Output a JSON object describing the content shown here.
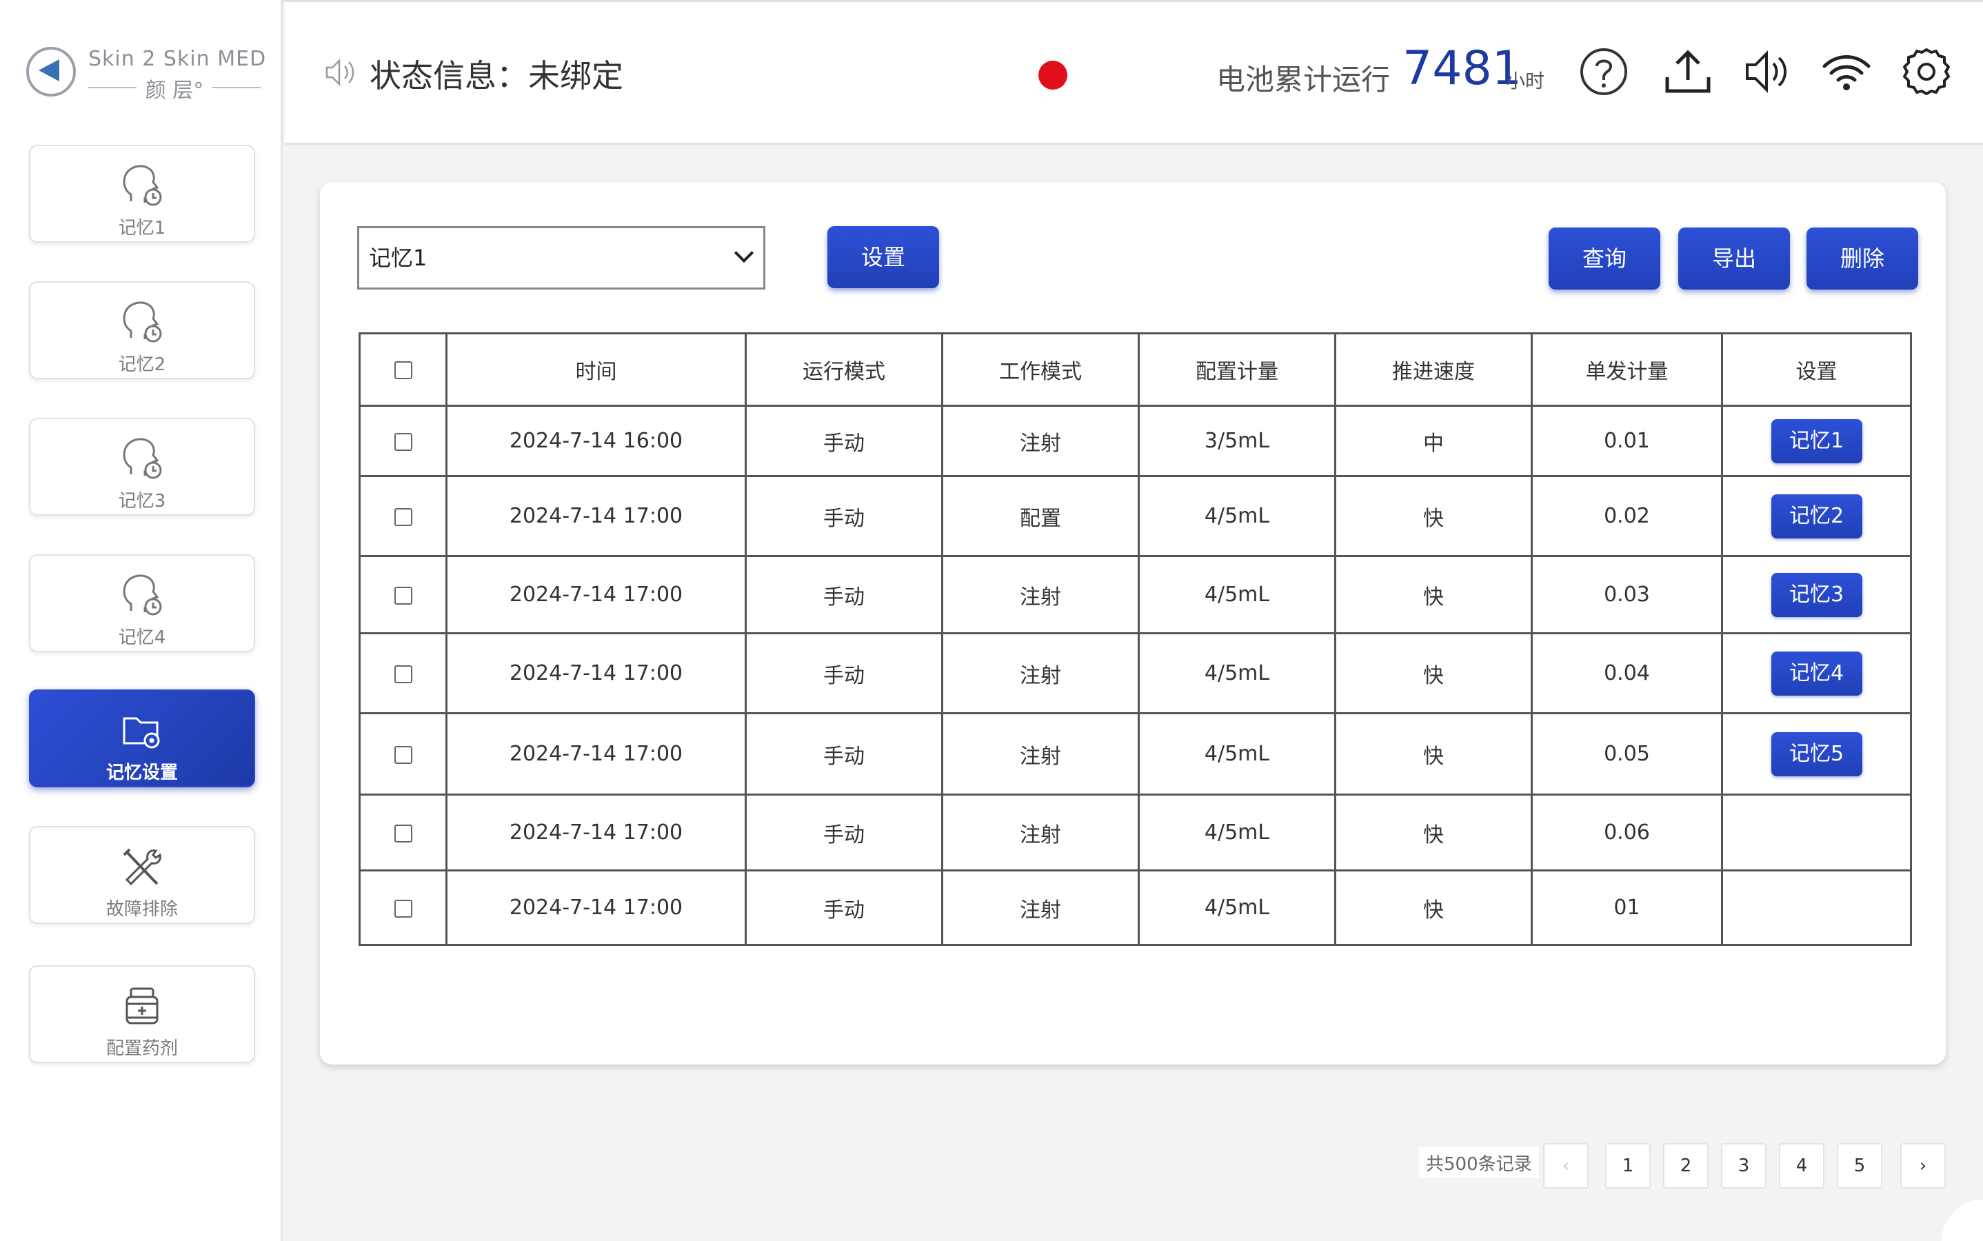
{
  "logo": {
    "line1": "Skin 2 Skin MED",
    "line2": "颜 层°"
  },
  "sidebar": {
    "items": [
      {
        "label": "记忆1",
        "icon": "head-clock-icon"
      },
      {
        "label": "记忆2",
        "icon": "head-clock-icon"
      },
      {
        "label": "记忆3",
        "icon": "head-clock-icon"
      },
      {
        "label": "记忆4",
        "icon": "head-clock-icon"
      },
      {
        "label": "记忆设置",
        "icon": "folder-gear-icon",
        "active": true
      },
      {
        "label": "故障排除",
        "icon": "tools-icon"
      },
      {
        "label": "配置药剂",
        "icon": "bottle-icon"
      }
    ]
  },
  "header": {
    "status_label": "状态信息：未绑定",
    "status_color": "#e0101a",
    "battery_label": "电池累计运行",
    "battery_value": "7481",
    "battery_unit": "小时",
    "icons": [
      "help-icon",
      "upload-icon",
      "volume-icon",
      "wifi-icon",
      "settings-icon"
    ]
  },
  "toolbar": {
    "select_value": "记忆1",
    "set_label": "设置",
    "query_label": "查询",
    "export_label": "导出",
    "delete_label": "删除"
  },
  "table": {
    "headers": [
      "时间",
      "运行模式",
      "工作模式",
      "配置计量",
      "推进速度",
      "单发计量",
      "设置"
    ],
    "rows": [
      {
        "time": "2024-7-14 16:00",
        "run_mode": "手动",
        "work_mode": "注射",
        "config": "3/5mL",
        "speed": "中",
        "dose": "0.01",
        "memory": "记忆1"
      },
      {
        "time": "2024-7-14 17:00",
        "run_mode": "手动",
        "work_mode": "配置",
        "config": "4/5mL",
        "speed": "快",
        "dose": "0.02",
        "memory": "记忆2"
      },
      {
        "time": "2024-7-14 17:00",
        "run_mode": "手动",
        "work_mode": "注射",
        "config": "4/5mL",
        "speed": "快",
        "dose": "0.03",
        "memory": "记忆3"
      },
      {
        "time": "2024-7-14 17:00",
        "run_mode": "手动",
        "work_mode": "注射",
        "config": "4/5mL",
        "speed": "快",
        "dose": "0.04",
        "memory": "记忆4"
      },
      {
        "time": "2024-7-14 17:00",
        "run_mode": "手动",
        "work_mode": "注射",
        "config": "4/5mL",
        "speed": "快",
        "dose": "0.05",
        "memory": "记忆5"
      },
      {
        "time": "2024-7-14 17:00",
        "run_mode": "手动",
        "work_mode": "注射",
        "config": "4/5mL",
        "speed": "快",
        "dose": "0.06",
        "memory": ""
      },
      {
        "time": "2024-7-14 17:00",
        "run_mode": "手动",
        "work_mode": "注射",
        "config": "4/5mL",
        "speed": "快",
        "dose": "01",
        "memory": ""
      }
    ]
  },
  "pagination": {
    "total_label": "共500条记录",
    "pages": [
      "1",
      "2",
      "3",
      "4",
      "5"
    ],
    "prev": "‹",
    "next": "›"
  },
  "colors": {
    "accent": "#2140b8",
    "battery_value": "#1d3aa2"
  }
}
